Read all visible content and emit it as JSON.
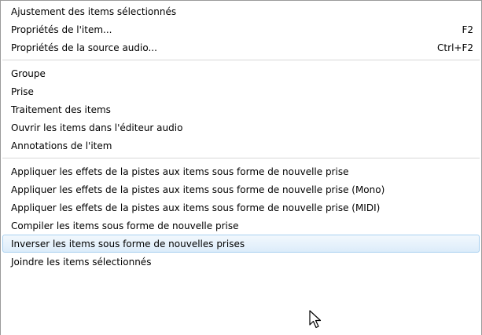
{
  "menu": {
    "group1": [
      {
        "label": "Ajustement des items sélectionnés",
        "shortcut": ""
      },
      {
        "label": "Propriétés de l'item...",
        "shortcut": "F2"
      },
      {
        "label": "Propriétés de la source audio...",
        "shortcut": "Ctrl+F2"
      }
    ],
    "group2": [
      {
        "label": "Groupe"
      },
      {
        "label": "Prise"
      },
      {
        "label": "Traitement des items"
      },
      {
        "label": "Ouvrir les items dans l'éditeur audio"
      },
      {
        "label": "Annotations de l'item"
      }
    ],
    "group3": [
      {
        "label": "Appliquer les effets de la pistes aux items sous forme de nouvelle prise"
      },
      {
        "label": "Appliquer les effets de la pistes aux items sous forme de nouvelle prise (Mono)"
      },
      {
        "label": "Appliquer les effets de la pistes aux items sous forme de nouvelle prise (MIDI)"
      },
      {
        "label": "Compiler les items sous forme de nouvelle prise"
      },
      {
        "label": "Inverser les items sous forme de nouvelles prises"
      },
      {
        "label": "Joindre les items sélectionnés"
      }
    ],
    "highlighted_item": "Inverser les items sous forme de nouvelles prises",
    "highlight_color": "#dcecfa",
    "separator_color": "#d7d7d7"
  }
}
